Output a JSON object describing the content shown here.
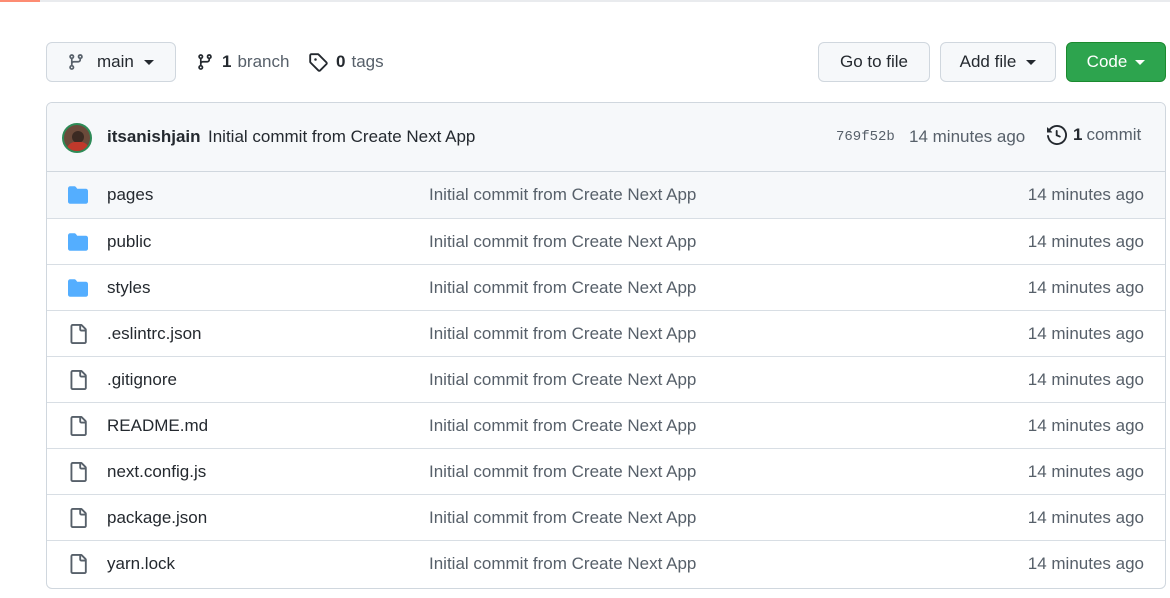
{
  "toolbar": {
    "branch_selector": "main",
    "branch_count": "1",
    "branch_label": "branch",
    "tag_count": "0",
    "tag_label": "tags",
    "go_to_file": "Go to file",
    "add_file": "Add file",
    "code": "Code"
  },
  "latest_commit": {
    "author": "itsanishjain",
    "message": "Initial commit from Create Next App",
    "sha": "769f52b",
    "time": "14 minutes ago",
    "count": "1",
    "count_label": "commit"
  },
  "files": [
    {
      "name": "pages",
      "type": "folder",
      "message": "Initial commit from Create Next App",
      "age": "14 minutes ago"
    },
    {
      "name": "public",
      "type": "folder",
      "message": "Initial commit from Create Next App",
      "age": "14 minutes ago"
    },
    {
      "name": "styles",
      "type": "folder",
      "message": "Initial commit from Create Next App",
      "age": "14 minutes ago"
    },
    {
      "name": ".eslintrc.json",
      "type": "file",
      "message": "Initial commit from Create Next App",
      "age": "14 minutes ago"
    },
    {
      "name": ".gitignore",
      "type": "file",
      "message": "Initial commit from Create Next App",
      "age": "14 minutes ago"
    },
    {
      "name": "README.md",
      "type": "file",
      "message": "Initial commit from Create Next App",
      "age": "14 minutes ago"
    },
    {
      "name": "next.config.js",
      "type": "file",
      "message": "Initial commit from Create Next App",
      "age": "14 minutes ago"
    },
    {
      "name": "package.json",
      "type": "file",
      "message": "Initial commit from Create Next App",
      "age": "14 minutes ago"
    },
    {
      "name": "yarn.lock",
      "type": "file",
      "message": "Initial commit from Create Next App",
      "age": "14 minutes ago"
    }
  ],
  "colors": {
    "folder": "#54aeff",
    "code_button": "#2da44e",
    "tab_accent": "#fd8c73"
  }
}
